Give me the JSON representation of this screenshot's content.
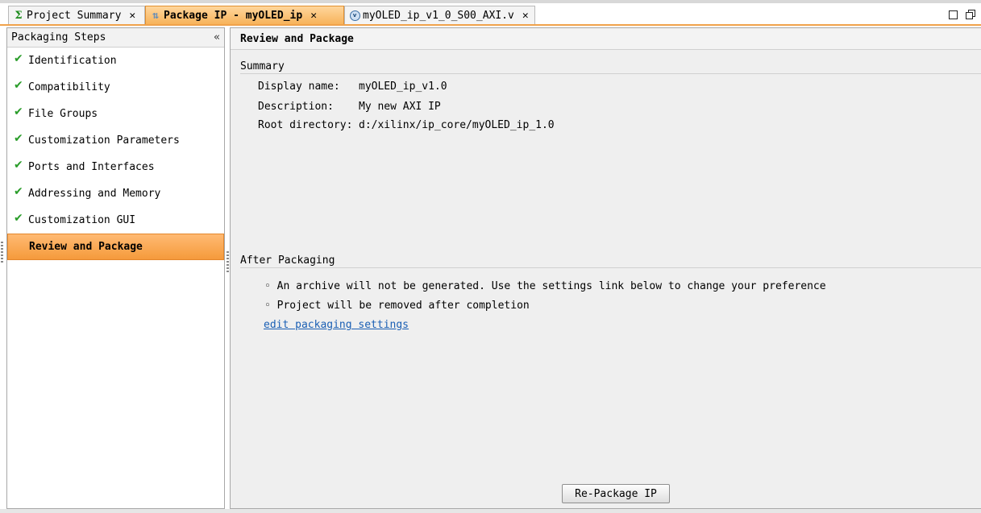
{
  "tabs": [
    {
      "label": "Project Summary",
      "icon": "sigma-icon",
      "active": false
    },
    {
      "label": "Package IP - myOLED_ip",
      "icon": "package-icon",
      "active": true
    },
    {
      "label": "myOLED_ip_v1_0_S00_AXI.v",
      "icon": "verilog-file-icon",
      "active": false
    }
  ],
  "left_panel": {
    "title": "Packaging Steps",
    "collapse_glyph": "«",
    "steps": [
      {
        "label": "Identification",
        "done": true
      },
      {
        "label": "Compatibility",
        "done": true
      },
      {
        "label": "File Groups",
        "done": true
      },
      {
        "label": "Customization Parameters",
        "done": true
      },
      {
        "label": "Ports and Interfaces",
        "done": true
      },
      {
        "label": "Addressing and Memory",
        "done": true
      },
      {
        "label": "Customization GUI",
        "done": true
      },
      {
        "label": "Review and Package",
        "done": false,
        "active": true
      }
    ]
  },
  "main": {
    "title": "Review and Package",
    "summary": {
      "heading": "Summary",
      "rows": [
        {
          "key": "Display name:",
          "value": "myOLED_ip_v1.0"
        },
        {
          "key": "Description:",
          "value": "My new AXI IP"
        },
        {
          "key": "Root directory:",
          "value": "d:/xilinx/ip_core/myOLED_ip_1.0"
        }
      ]
    },
    "after_packaging": {
      "heading": "After Packaging",
      "items": [
        "An archive will not be generated. Use the settings link below to change your preference",
        "Project will be removed after completion"
      ],
      "link": "edit packaging settings"
    },
    "button_label": "Re-Package IP"
  },
  "colors": {
    "active_tab": "#f7b35b",
    "active_step": "#f59a3b",
    "check": "#2a9d2a",
    "link": "#1a5fb4"
  }
}
